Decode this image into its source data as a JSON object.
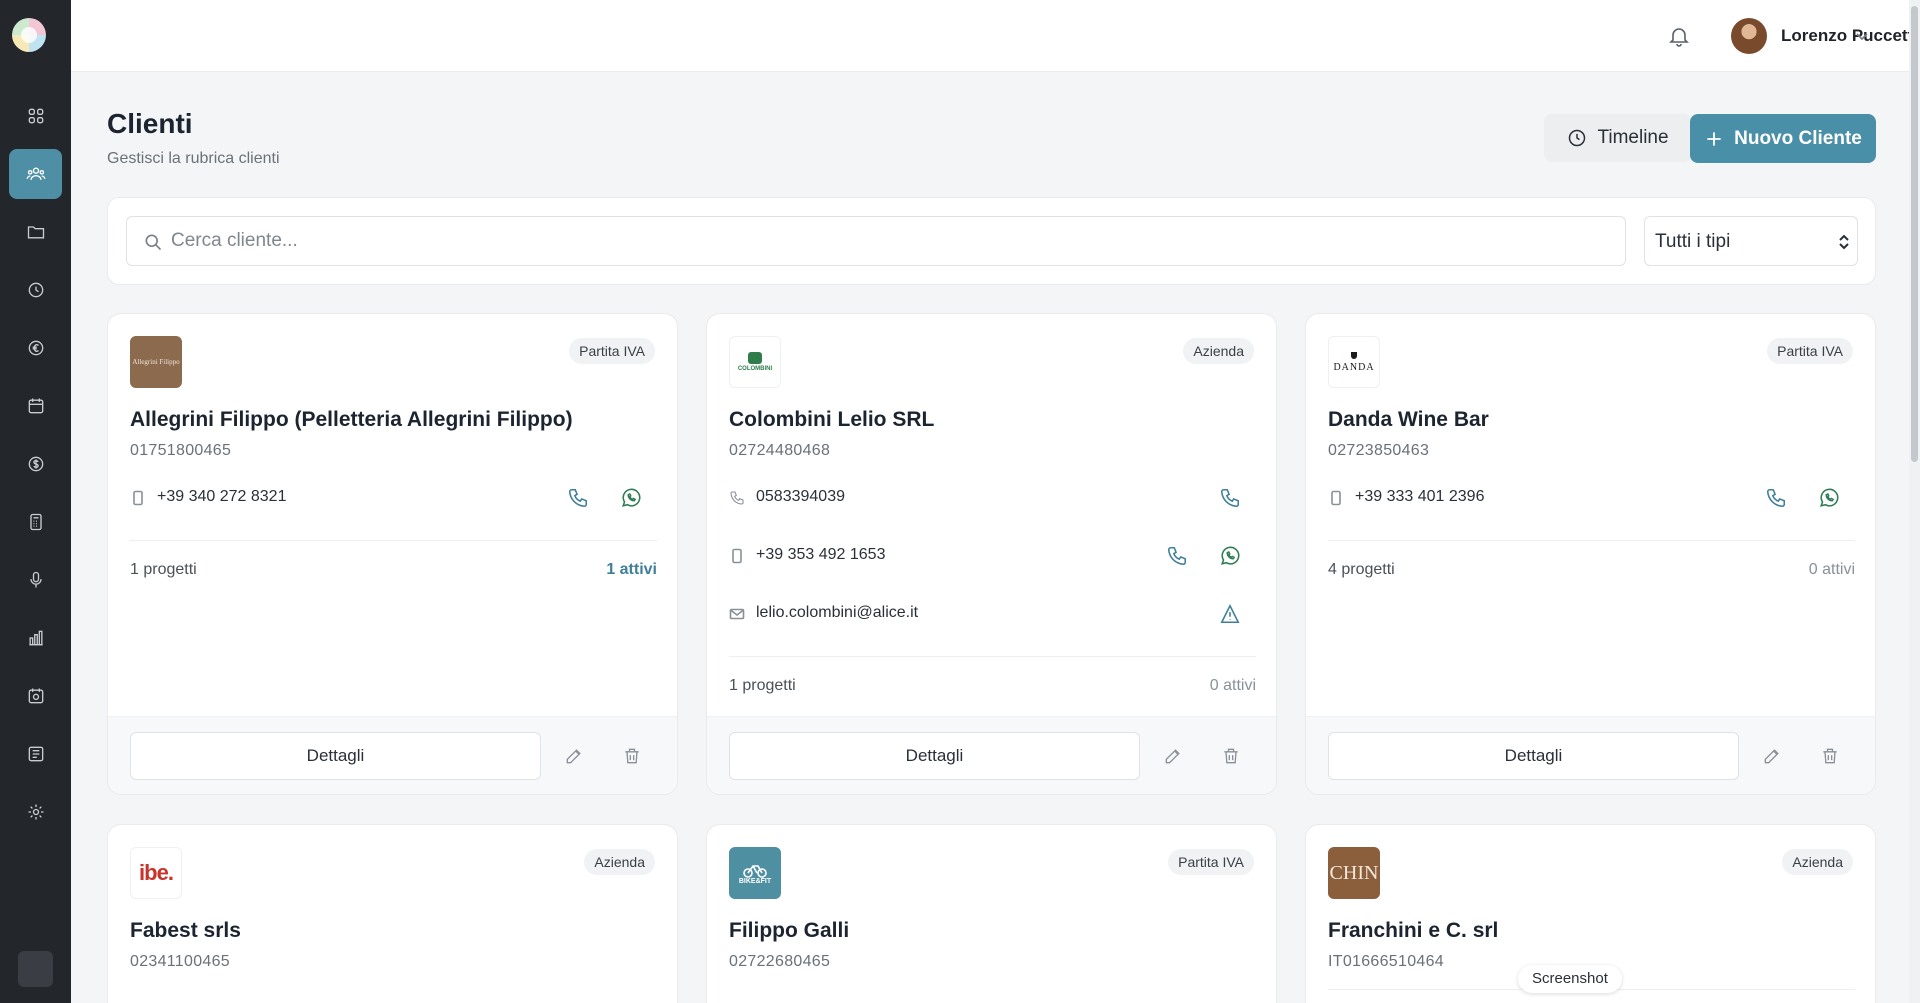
{
  "header": {
    "title": "Clienti",
    "subtitle": "Gestisci la rubrica clienti",
    "timeline_label": "Timeline",
    "new_client_label": "Nuovo Cliente"
  },
  "topbar": {
    "user_name": "Lorenzo Puccetti"
  },
  "filters": {
    "search_placeholder": "Cerca cliente...",
    "type_select_value": "Tutti i tipi"
  },
  "sidebar": {
    "items": [
      "dashboard-icon",
      "users-icon",
      "folder-icon",
      "clock-icon",
      "euro-icon",
      "calendar-icon",
      "dollar-icon",
      "calculator-icon",
      "microphone-icon",
      "bar-chart-icon",
      "calendar-check-icon",
      "newspaper-icon",
      "gear-icon"
    ],
    "active_index": 1
  },
  "labels": {
    "details": "Dettagli"
  },
  "clients": [
    {
      "name": "Allegrini Filippo (Pelletteria Allegrini Filippo)",
      "code": "01751800465",
      "type": "Partita IVA",
      "logo_text": "Allegrini Filippo",
      "mobile": "+39 340 272 8321",
      "projects": "1 progetti",
      "active": "1 attivi"
    },
    {
      "name": "Colombini Lelio SRL",
      "code": "02724480468",
      "type": "Azienda",
      "logo_text": "COLOMBINI",
      "phone": "0583394039",
      "mobile": "+39 353 492 1653",
      "email": "lelio.colombini@alice.it",
      "projects": "1 progetti",
      "active": "0 attivi"
    },
    {
      "name": "Danda Wine Bar",
      "code": "02723850463",
      "type": "Partita IVA",
      "logo_text": "DANDA",
      "mobile": "+39 333 401 2396",
      "projects": "4 progetti",
      "active": "0 attivi"
    },
    {
      "name": "Fabest srls",
      "code": "02341100465",
      "type": "Azienda",
      "logo_text": "ibe."
    },
    {
      "name": "Filippo Galli",
      "code": "02722680465",
      "type": "Partita IVA",
      "logo_text": "BIKE&FIT"
    },
    {
      "name": "Franchini e C. srl",
      "code": "IT01666510464",
      "type": "Azienda",
      "logo_text": "CHIN"
    }
  ],
  "tooltip": "Screenshot",
  "colors": {
    "accent": "#4a8fa8",
    "sidebar_bg": "#23262b",
    "whatsapp": "#2f7d55"
  }
}
